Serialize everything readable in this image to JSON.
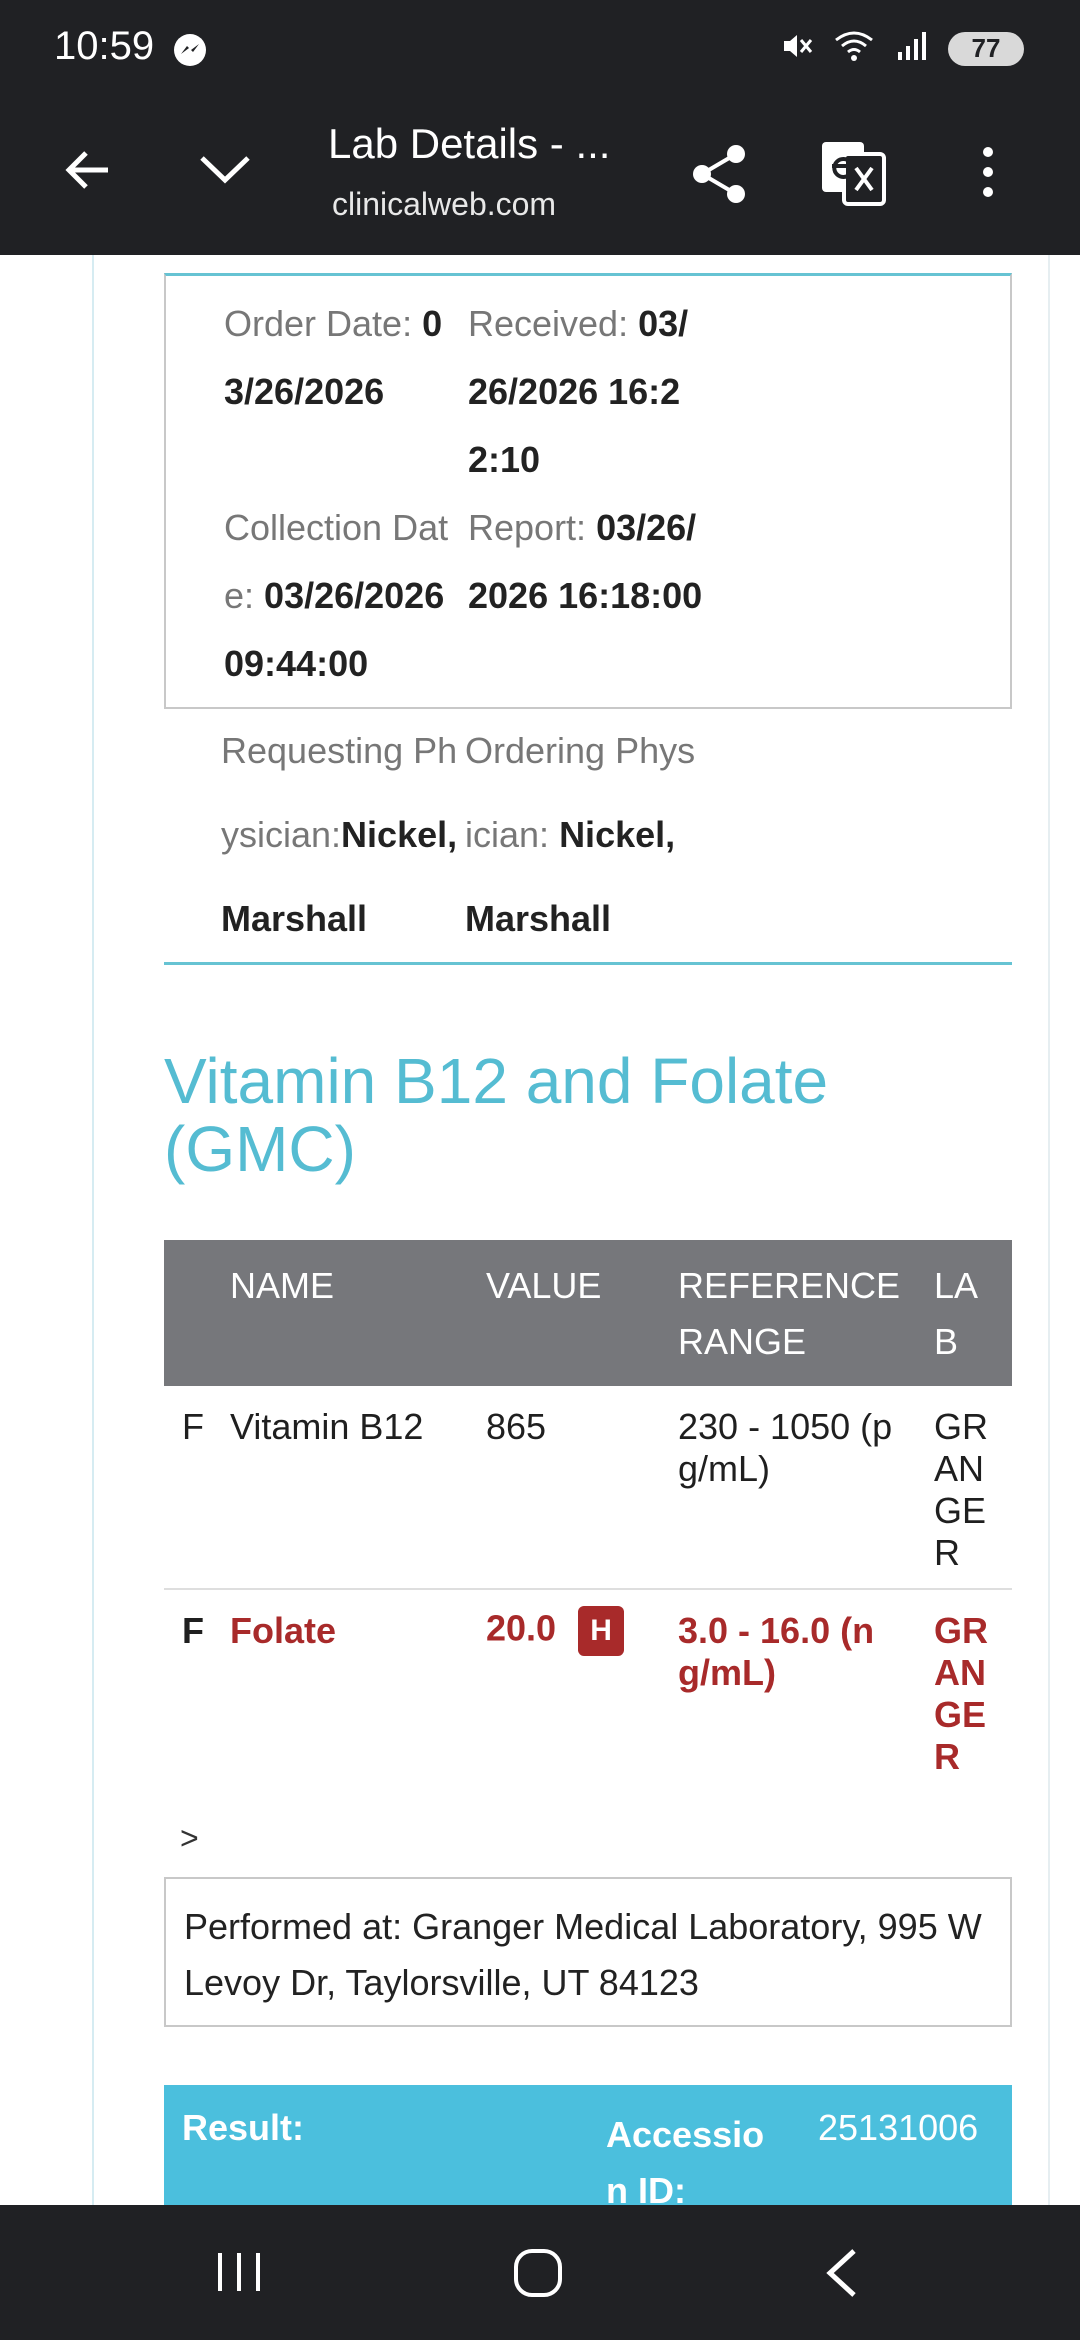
{
  "status_bar": {
    "time": "10:59",
    "battery": "77",
    "network": "6E"
  },
  "toolbar": {
    "title": "Lab Details - ...",
    "url": "clinicalweb.com"
  },
  "dates": {
    "order_label": "Order Date:",
    "order_value": "03/26/2026",
    "received_label": "Received:",
    "received_value": "03/26/2026 16:22:10",
    "collection_label": "Collection Date:",
    "collection_value": "03/26/2026 09:44:00",
    "report_label": "Report:",
    "report_value": "03/26/2026 16:18:00"
  },
  "physicians": {
    "requesting_label": "Requesting Physician:",
    "requesting_value": "Nickel, Marshall",
    "ordering_label": "Ordering Physician:",
    "ordering_value": "Nickel, Marshall"
  },
  "section_title": "Vitamin B12 and Folate (GMC)",
  "table": {
    "headers": [
      "NAME",
      "VALUE",
      "REFERENCE RANGE",
      "LAB"
    ],
    "rows": [
      {
        "flag": "F",
        "name": "Vitamin B12",
        "value": "865",
        "range": "230 - 1050 (pg/mL)",
        "lab": "GRANGER",
        "abnormal": false
      },
      {
        "flag": "F",
        "name": "Folate",
        "value": "20.0",
        "badge": "H",
        "range": "3.0 - 16.0 (ng/mL)",
        "lab": "GRANGER",
        "abnormal": true
      }
    ]
  },
  "expand_glyph": ">",
  "performed_at": "Performed at: Granger Medical Laboratory, 995 W Levoy Dr, Taylorsville, UT 84123",
  "result_bar": {
    "result_label": "Result:",
    "accession_label": "Accession ID:",
    "accession_value": "25131006"
  },
  "colors": {
    "accent": "#55bcd2",
    "abnormal": "#a82a2a",
    "header_gray": "#76777b",
    "result_bar": "#4bbfdd"
  }
}
